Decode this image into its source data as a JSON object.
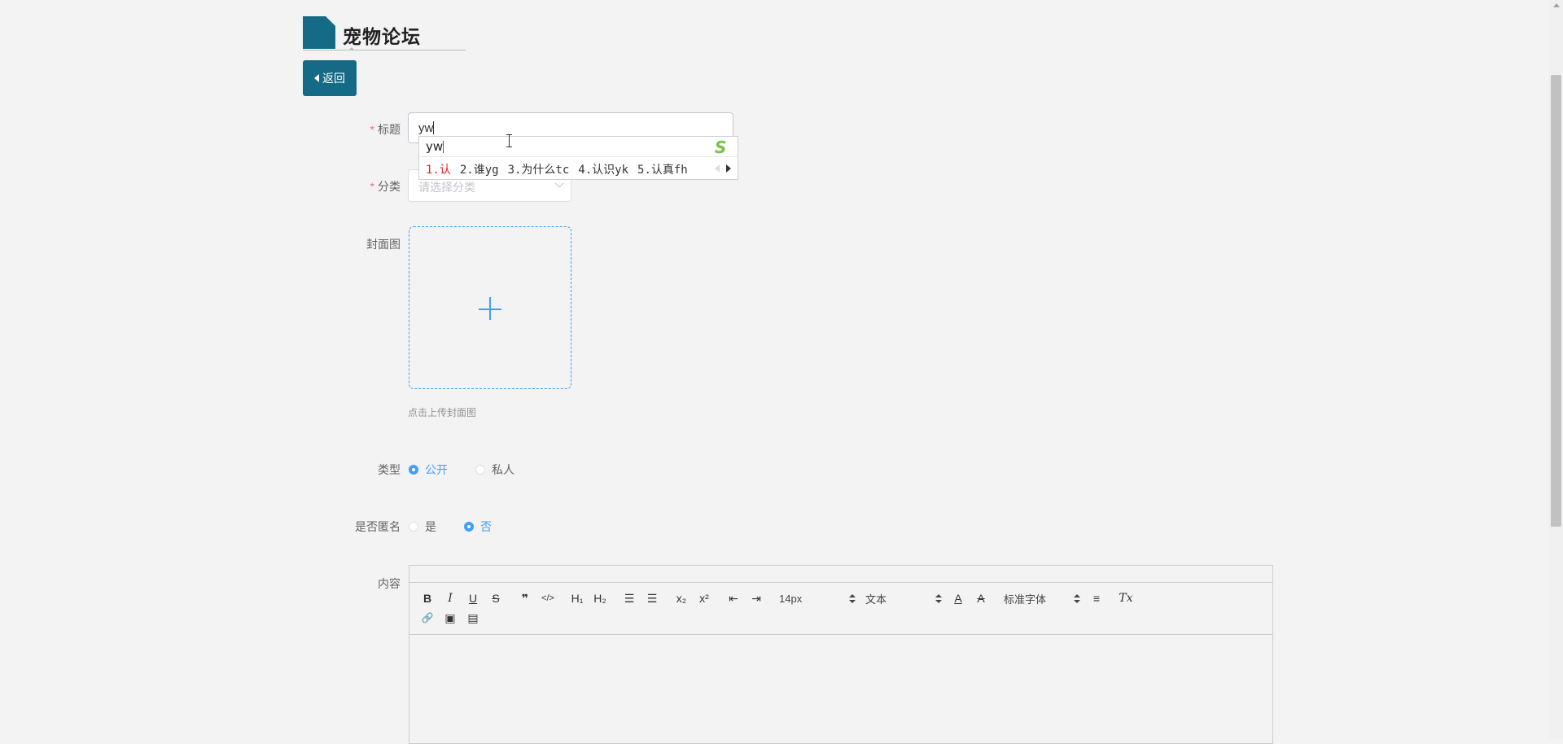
{
  "header": {
    "title": "宠物论坛"
  },
  "back_button": {
    "label": "返回"
  },
  "form": {
    "title_field": {
      "label": "标题",
      "required_mark": "*",
      "value": "yw"
    },
    "category_field": {
      "label": "分类",
      "required_mark": "*",
      "placeholder": "请选择分类"
    },
    "cover_field": {
      "label": "封面图",
      "tip": "点击上传封面图"
    },
    "type_field": {
      "label": "类型",
      "options": [
        "公开",
        "私人"
      ],
      "selected": "公开"
    },
    "anonymous_field": {
      "label": "是否匿名",
      "options": [
        "是",
        "否"
      ],
      "selected": "否"
    },
    "content_field": {
      "label": "内容"
    }
  },
  "ime": {
    "input": "yw",
    "candidates": [
      "1.认",
      "2.谁yg",
      "3.为什么tc",
      "4.认识yk",
      "5.认真fh"
    ],
    "logo": "S"
  },
  "editor": {
    "toolbar": {
      "bold": "B",
      "italic": "I",
      "underline": "U",
      "strike": "S",
      "quote": "❞",
      "code": "</>",
      "h1": "H₁",
      "h2": "H₂",
      "ordered_list": "☰",
      "bullet_list": "☰",
      "subscript": "x₂",
      "superscript": "x²",
      "outdent": "⇤",
      "indent": "⇥",
      "font_size": "14px",
      "header_select": "文本",
      "font_color": "A",
      "background": "A",
      "font_family": "标准字体",
      "align": "≡",
      "clean": "Tx",
      "link": "🔗",
      "image": "▣",
      "video": "▤"
    },
    "colors": {
      "accent": "#409eff",
      "brand": "#156a85",
      "required": "#f56c6c"
    }
  }
}
